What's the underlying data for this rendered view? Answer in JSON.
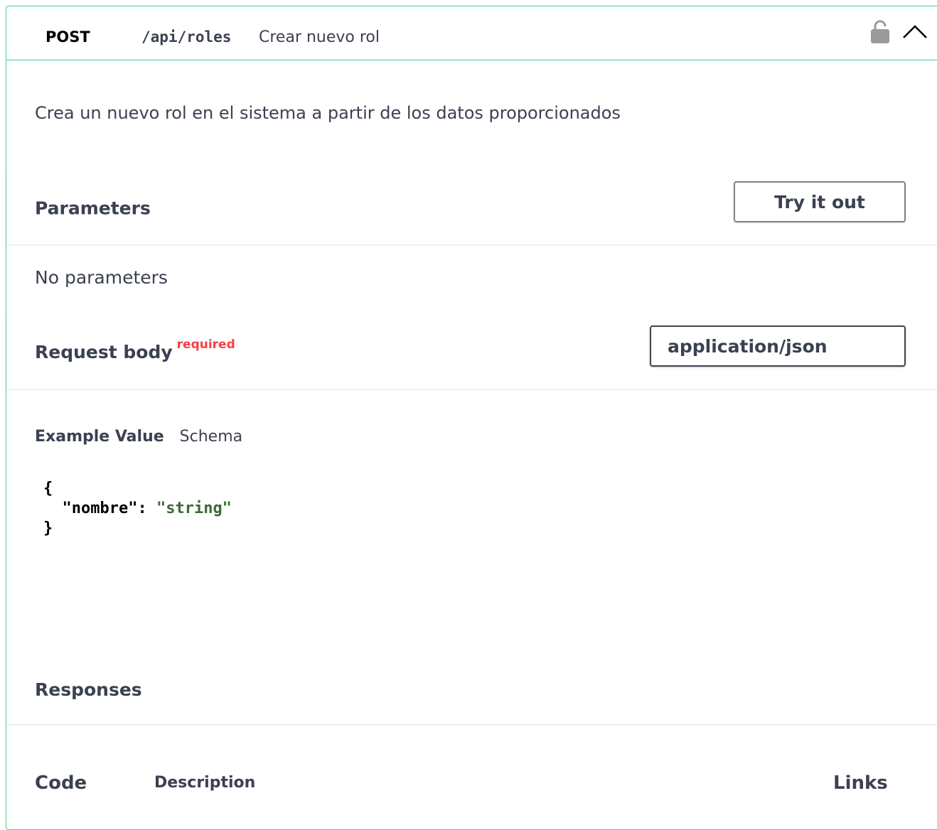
{
  "operation": {
    "method": "POST",
    "path": "/api/roles",
    "summary": "Crear nuevo rol",
    "description": "Crea un nuevo rol en el sistema a partir de los datos proporcionados"
  },
  "icons": {
    "lock": "lock-icon",
    "collapse": "chevron-up-icon"
  },
  "parameters": {
    "title": "Parameters",
    "try_label": "Try it out",
    "empty_text": "No parameters"
  },
  "request_body": {
    "title": "Request body",
    "required_label": "required",
    "content_type": "application/json",
    "tabs": {
      "example_label": "Example Value",
      "schema_label": "Schema"
    },
    "example": {
      "open": "{",
      "key": "\"nombre\"",
      "colon": ": ",
      "value": "\"string\"",
      "close": "}"
    }
  },
  "responses": {
    "title": "Responses",
    "columns": {
      "code": "Code",
      "description": "Description",
      "links": "Links"
    }
  },
  "colors": {
    "post_border": "#49cc90",
    "required": "#f93e3e",
    "string_value": "#3a6b35",
    "text": "#3b4151"
  }
}
